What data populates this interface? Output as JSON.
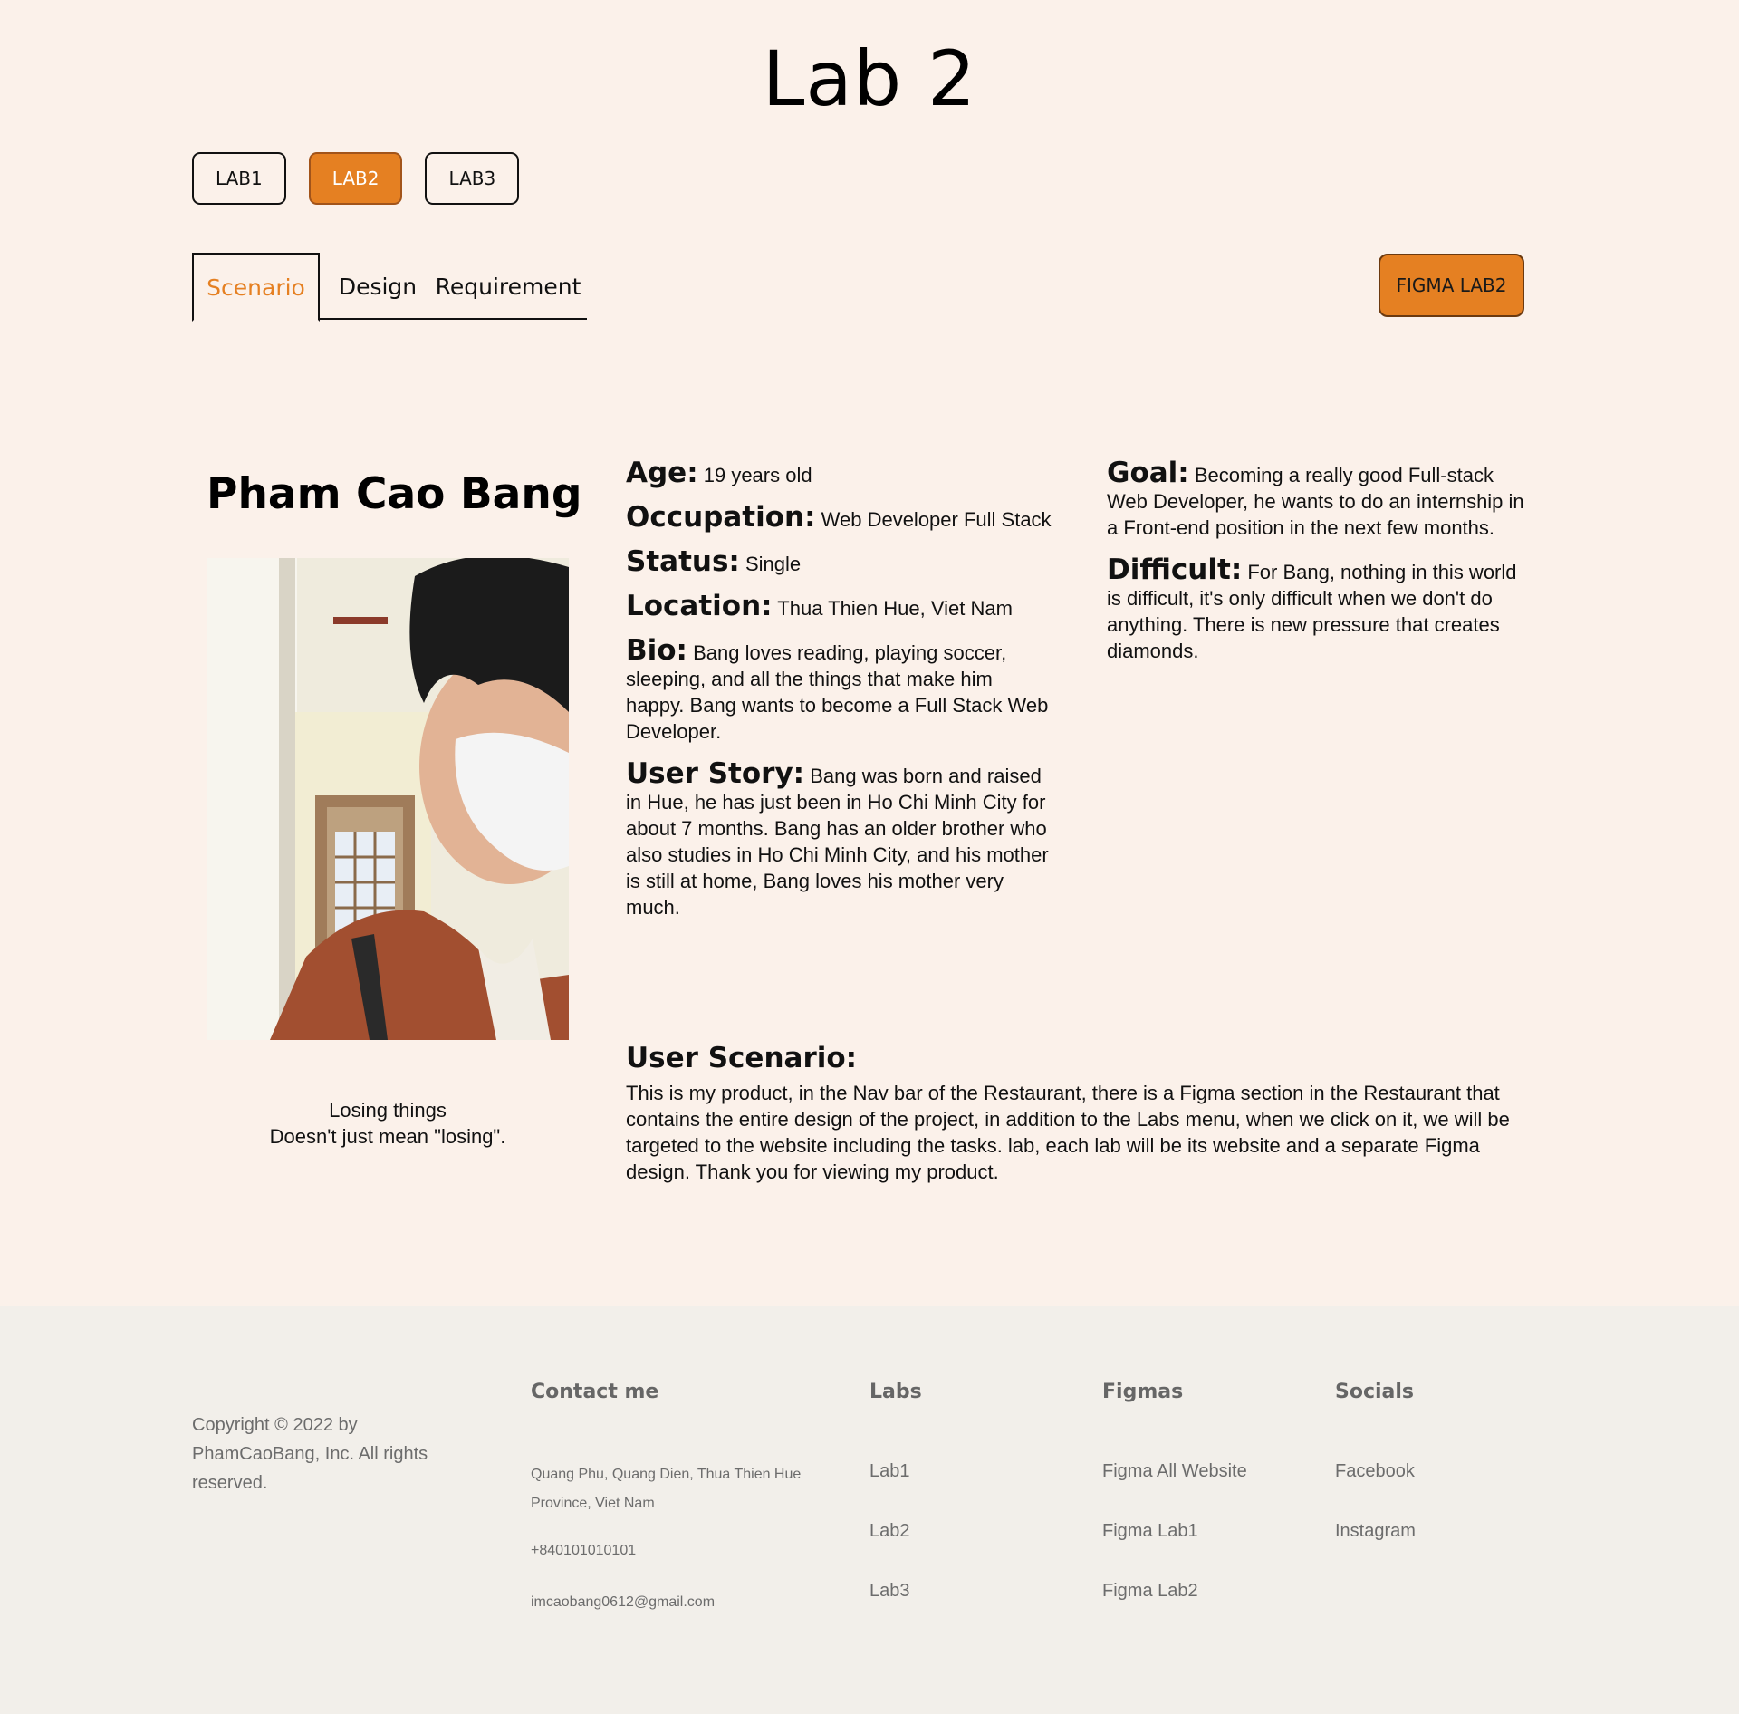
{
  "page_title": "Lab 2",
  "lab_nav": [
    {
      "label": "LAB1"
    },
    {
      "label": "LAB2"
    },
    {
      "label": "LAB3"
    }
  ],
  "tabs": [
    {
      "label": "Scenario"
    },
    {
      "label": "Design"
    },
    {
      "label": "Requirement"
    }
  ],
  "figma_button": "FIGMA LAB2",
  "profile": {
    "name": "Pham Cao Bang",
    "quote_line1": "Losing things",
    "quote_line2": "Doesn't just mean \"losing\".",
    "age_label": "Age:",
    "age": "19 years old",
    "occupation_label": "Occupation:",
    "occupation": "Web Developer Full Stack",
    "status_label": "Status:",
    "status": "Single",
    "location_label": "Location:",
    "location": "Thua Thien Hue, Viet Nam",
    "bio_label": "Bio:",
    "bio": "Bang loves reading, playing soccer, sleeping, and all the things that make him happy. Bang wants to become a Full Stack Web Developer.",
    "story_label": "User Story:",
    "story": "Bang was born and raised in Hue, he has just been in Ho Chi Minh City for about 7 months. Bang has an older brother who also studies in Ho Chi Minh City, and his mother is still at home, Bang loves his mother very much.",
    "goal_label": "Goal:",
    "goal": "Becoming a really good Full-stack Web Developer, he wants to do an internship in a Front-end position in the next few months.",
    "difficult_label": "Difficult:",
    "difficult": "For Bang, nothing in this world is difficult, it's only difficult when we don't do anything. There is new pressure that creates diamonds.",
    "scenario_label": "User Scenario:",
    "scenario": "This is my product, in the Nav bar of the Restaurant, there is a Figma section in the Restaurant that contains the entire design of the project, in addition to the Labs menu, when we click on it, we will be targeted to the website including the tasks. lab, each lab will be its website and a separate Figma design. Thank you for viewing my product."
  },
  "footer": {
    "copyright": "Copyright © 2022 by PhamCaoBang, Inc. All rights reserved.",
    "contact": {
      "heading": "Contact me",
      "address": "Quang Phu, Quang Dien, Thua Thien Hue Province, Viet Nam",
      "phone": "+840101010101",
      "email": "imcaobang0612@gmail.com"
    },
    "labs": {
      "heading": "Labs",
      "links": [
        "Lab1",
        "Lab2",
        "Lab3"
      ]
    },
    "figmas": {
      "heading": "Figmas",
      "links": [
        "Figma All Website",
        "Figma Lab1",
        "Figma Lab2"
      ]
    },
    "socials": {
      "heading": "Socials",
      "links": [
        "Facebook",
        "Instagram"
      ]
    }
  },
  "colors": {
    "background": "#fbf1ea",
    "accent": "#e58022",
    "footer_bg": "#f2efea"
  }
}
